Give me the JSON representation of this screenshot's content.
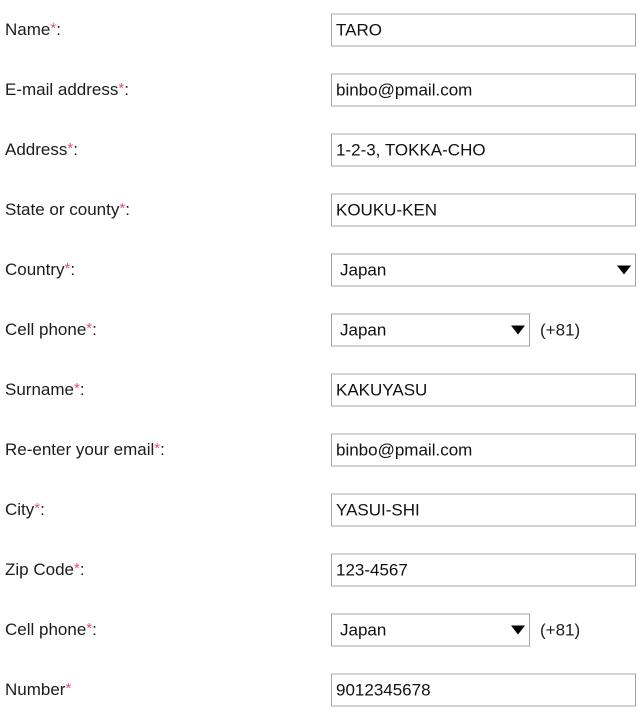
{
  "form": {
    "required_marker": "*",
    "required_marker_color": "#f8486c",
    "field_border_color": "#a3a3a3",
    "field_background_color": "#ffffff",
    "label_color": "#1c1c1c",
    "rows": [
      {
        "label": "Name",
        "suffix_colon": ":",
        "required": true,
        "control": "text",
        "value": "TARO"
      },
      {
        "label": "E-mail address",
        "suffix_colon": ":",
        "required": true,
        "control": "text",
        "value": "binbo@pmail.com"
      },
      {
        "label": "Address",
        "suffix_colon": ":",
        "required": true,
        "control": "text",
        "value": "1-2-3, TOKKA-CHO"
      },
      {
        "label": "State or county",
        "suffix_colon": ":",
        "required": true,
        "control": "text",
        "value": "KOUKU-KEN"
      },
      {
        "label": "Country",
        "suffix_colon": ":",
        "required": true,
        "control": "select-wide",
        "value": "Japan"
      },
      {
        "label": "Cell phone",
        "suffix_colon": ":",
        "required": true,
        "control": "select-narrow",
        "value": "Japan",
        "suffix": "(+81)"
      },
      {
        "label": "Surname",
        "suffix_colon": ":",
        "required": true,
        "control": "text",
        "value": "KAKUYASU"
      },
      {
        "label": "Re-enter your email",
        "suffix_colon": ":",
        "required": true,
        "control": "text",
        "value": "binbo@pmail.com"
      },
      {
        "label": "City",
        "suffix_colon": ":",
        "required": true,
        "control": "text",
        "value": "YASUI-SHI"
      },
      {
        "label": "Zip Code",
        "suffix_colon": ":",
        "required": true,
        "control": "text",
        "value": "123-4567"
      },
      {
        "label": "Cell phone",
        "suffix_colon": ":",
        "required": true,
        "control": "select-narrow",
        "value": "Japan",
        "suffix": "(+81)"
      },
      {
        "label": "Number",
        "suffix_colon": "",
        "required": true,
        "control": "text",
        "value": "9012345678"
      }
    ]
  }
}
